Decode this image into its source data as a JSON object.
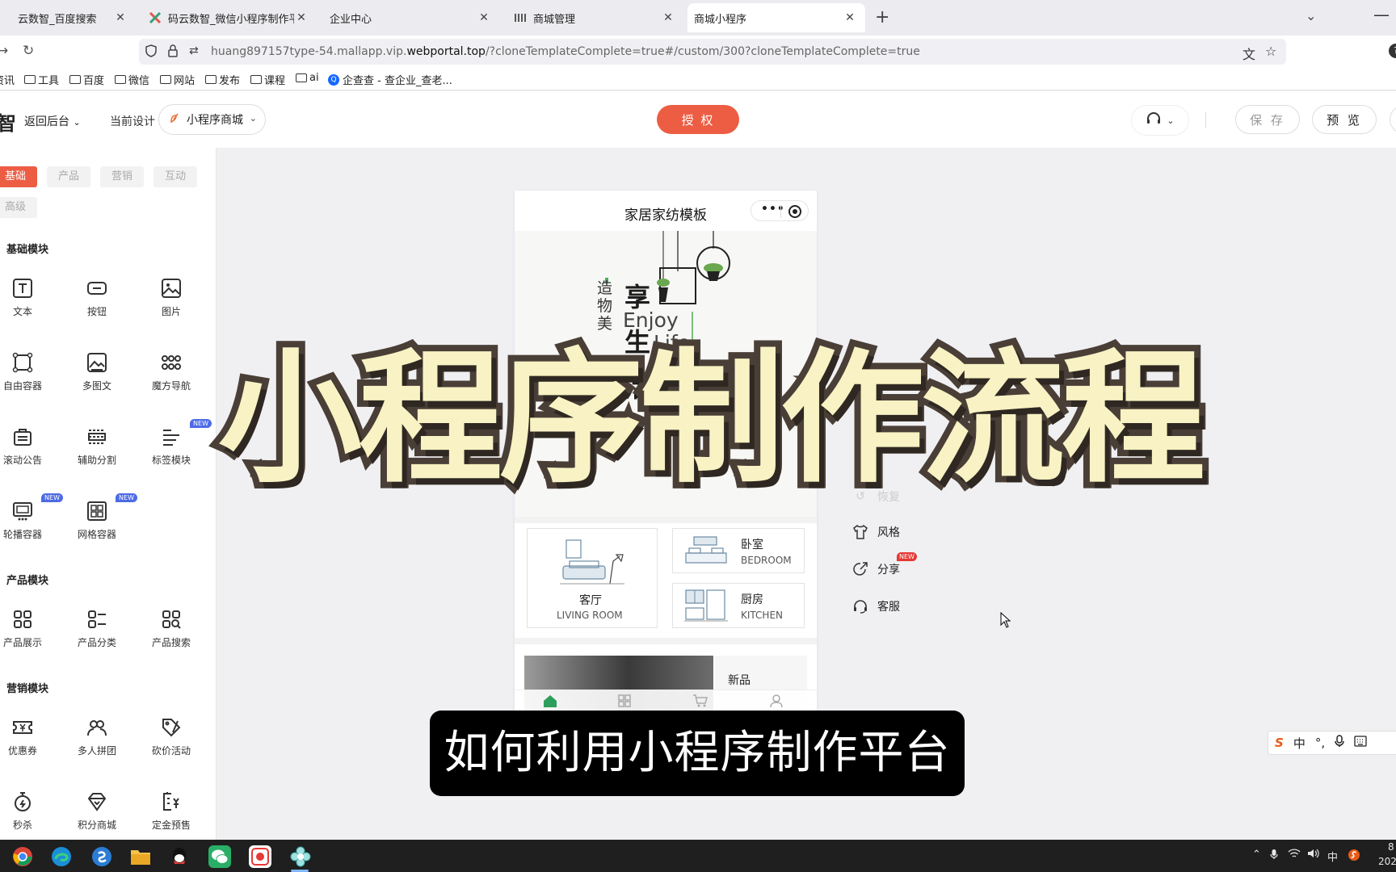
{
  "browser": {
    "tabs": [
      {
        "title": "云数智_百度搜索",
        "icon": "paw-icon"
      },
      {
        "title": "码云数智_微信小程序制作平台_",
        "icon": "x-logo-icon"
      },
      {
        "title": "企业中心",
        "icon": "none"
      },
      {
        "title": "商城管理",
        "icon": "grid-icon"
      },
      {
        "title": "商城小程序",
        "icon": "none"
      }
    ],
    "new_tab": "+",
    "url_plain": "huang897157type-54.mallapp.vip.",
    "url_domain": "webportal.top",
    "url_rest": "/?cloneTemplateComplete=true#/custom/300?cloneTemplateComplete=true",
    "bookmarks": [
      "资讯",
      "工具",
      "百度",
      "微信",
      "网站",
      "发布",
      "课程",
      "ai",
      "企查查 - 查企业_查老..."
    ]
  },
  "header": {
    "logo": "智",
    "back_label": "返回后台",
    "current_design_label": "当前设计",
    "design_name": "小程序商城",
    "auth_label": "授 权",
    "save_label": "保 存",
    "preview_label": "预 览"
  },
  "left_panel": {
    "category_tabs": [
      "基础",
      "产品",
      "营销",
      "互动",
      "高级"
    ],
    "sections": [
      {
        "title": "基础模块",
        "items": [
          "文本",
          "按钮",
          "图片",
          "自由容器",
          "多图文",
          "魔方导航",
          "滚动公告",
          "辅助分割",
          "标签模块",
          "轮播容器",
          "网格容器"
        ]
      },
      {
        "title": "产品模块",
        "items": [
          "产品展示",
          "产品分类",
          "产品搜索"
        ]
      },
      {
        "title": "营销模块",
        "items": [
          "优惠券",
          "多人拼团",
          "砍价活动",
          "秒杀",
          "积分商城",
          "定金预售"
        ]
      }
    ],
    "new_badge": "NEW"
  },
  "phone": {
    "title": "家居家纺模板",
    "banner": {
      "vertical_small": "造物美",
      "vertical_big": "享生活",
      "enjoy": "Enjoy",
      "life": "Life"
    },
    "categories": [
      {
        "name": "客厅",
        "en": "LIVING ROOM"
      },
      {
        "name": "卧室",
        "en": "BEDROOM"
      },
      {
        "name": "厨房",
        "en": "KITCHEN"
      }
    ],
    "new_label": "新品"
  },
  "tools": [
    {
      "label": "恢复",
      "icon": "restore-icon"
    },
    {
      "label": "风格",
      "icon": "shirt-icon"
    },
    {
      "label": "分享",
      "icon": "share-icon",
      "badge": "NEW"
    },
    {
      "label": "客服",
      "icon": "headset-icon"
    }
  ],
  "ime": {
    "lang": "中",
    "punct": "°,"
  },
  "overlay": {
    "big_title": "小程序制作流程",
    "subtitle": "如何利用小程序制作平台"
  },
  "taskbar": {
    "tray_lang": "中",
    "clock_top": "8",
    "clock_bottom": "202"
  },
  "colors": {
    "accent": "#ec5d44",
    "new_badge_blue": "#4d6be6",
    "new_badge_red": "#e53935",
    "overlay_fill": "#f8f2c4",
    "overlay_stroke": "#4a3f37"
  }
}
